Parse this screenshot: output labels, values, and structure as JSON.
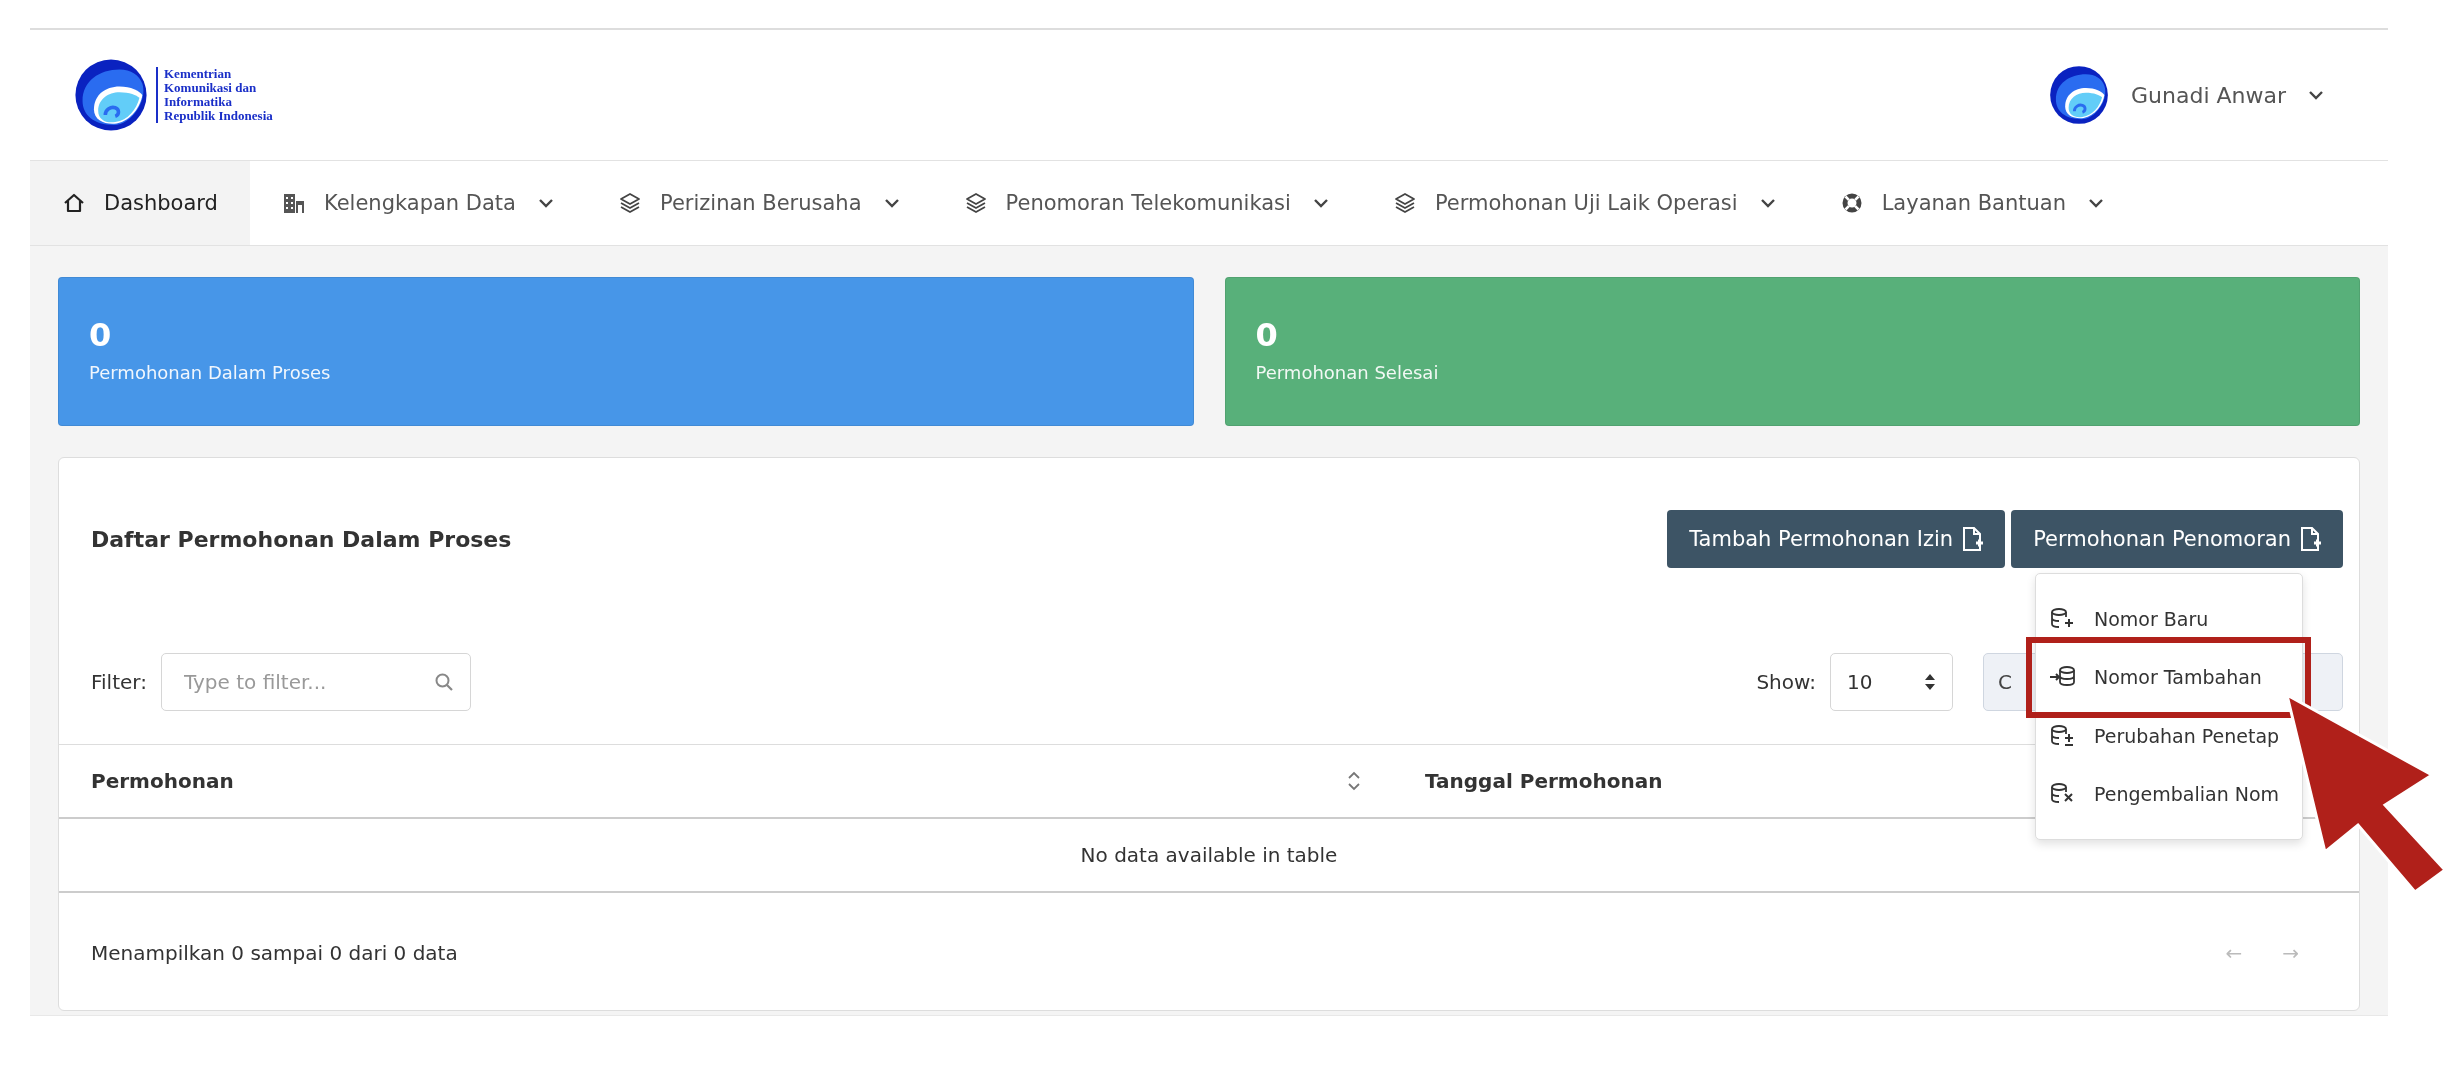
{
  "header": {
    "logo_lines": [
      "Kementrian",
      "Komunikasi dan",
      "Informatika",
      "Republik Indonesia"
    ],
    "user": "Gunadi Anwar"
  },
  "nav": [
    {
      "label": "Dashboard",
      "selected": true,
      "dropdown": false
    },
    {
      "label": "Kelengkapan Data",
      "selected": false,
      "dropdown": true
    },
    {
      "label": "Perizinan Berusaha",
      "selected": false,
      "dropdown": true
    },
    {
      "label": "Penomoran Telekomunikasi",
      "selected": false,
      "dropdown": true
    },
    {
      "label": "Permohonan Uji Laik Operasi",
      "selected": false,
      "dropdown": true
    },
    {
      "label": "Layanan Bantuan",
      "selected": false,
      "dropdown": true
    }
  ],
  "stats": [
    {
      "value": "0",
      "label": "Permohonan Dalam Proses",
      "color": "#4796e8"
    },
    {
      "value": "0",
      "label": "Permohonan Selesai",
      "color": "#58b07a"
    }
  ],
  "panel": {
    "title": "Daftar Permohonan Dalam Proses",
    "buttons": [
      "Tambah Permohonan Izin",
      "Permohonan Penomoran"
    ],
    "menu": [
      "Nomor Baru",
      "Nomor Tambahan",
      "Perubahan Penetap",
      "Pengembalian Nom"
    ],
    "filter": {
      "label": "Filter:",
      "placeholder": "Type to filter..."
    },
    "show": {
      "label": "Show:",
      "value": "10"
    },
    "hidden_button": "C",
    "columns": [
      "Permohonan",
      "Tanggal Permohonan"
    ],
    "empty": "No data available in table",
    "info": "Menampilkan 0 sampai 0 dari 0 data",
    "pager": [
      "←",
      "→"
    ]
  }
}
